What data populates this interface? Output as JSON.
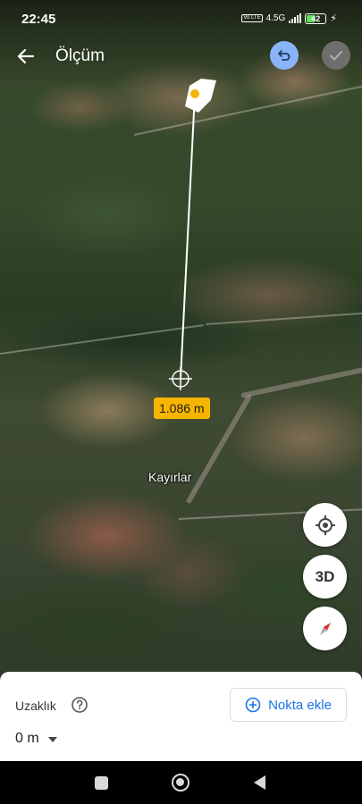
{
  "status_bar": {
    "time": "22:45",
    "network_tag": "Vo LTE",
    "network_type": "4.5G",
    "battery_level": "42"
  },
  "header": {
    "title": "Ölçüm",
    "back_icon": "arrow-back-icon",
    "undo_icon": "undo-icon",
    "done_icon": "check-icon"
  },
  "map": {
    "distance_label": "1.086 m",
    "place_label": "Kayırlar"
  },
  "controls": {
    "locate_icon": "my-location-icon",
    "view_3d_label": "3D",
    "compass_icon": "compass-icon"
  },
  "bottom_panel": {
    "distance_title": "Uzaklık",
    "help_icon": "help-icon",
    "distance_value": "0 m",
    "add_point_label": "Nokta ekle"
  },
  "colors": {
    "accent": "#1a73e8",
    "label_bg": "#f6b500",
    "undo_bg": "#8ab4f8"
  }
}
